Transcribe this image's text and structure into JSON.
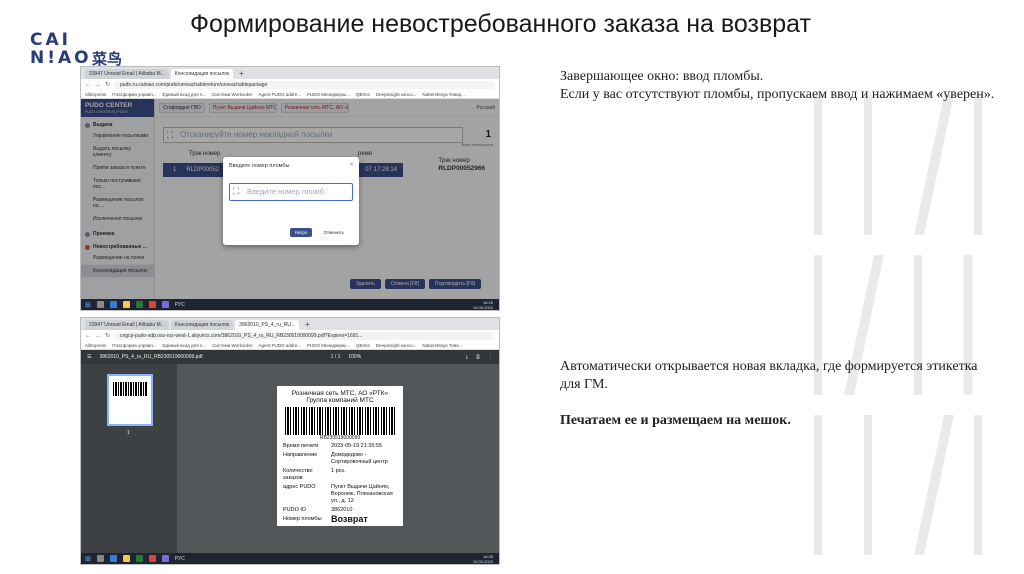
{
  "slide": {
    "logo_line1": "CAI",
    "logo_line2": "N!AO",
    "logo_cn": "菜鸟",
    "title": "Формирование невостребованного заказа на возврат",
    "note1": "Завершающее окно: ввод пломбы.\nЕсли у вас отсутствуют пломбы, пропускаем ввод и нажимаем «уверен».",
    "note2_text": "Автоматически открывается новая вкладка, где формируется этикетка для ГМ.",
    "note2_bold": "Печатаем ее и размещаем на мешок."
  },
  "shot1": {
    "tabs": [
      "23947 Unread Email | Alibaba M...",
      "Консолидация посылок"
    ],
    "url": "pudo.ru.cainiao.com/pudo/unreachablereturn/unreachablepackage",
    "bookmarks": [
      "AliExpress",
      "Платформа управл...",
      "Единый вход для п...",
      "Система Workorder",
      "Agent PUDO addre...",
      "PUDO Менеджеры...",
      "QBIms",
      "Deepinsight консо...",
      "Nabershtsya Товар..."
    ],
    "brand": "PUDO CENTER",
    "brand_sub": "PUDO CENTER RU PUDO",
    "sidebar": {
      "section1": "Выдача",
      "section1_items": [
        "Управление посылками",
        "Выдать посылку клиенту",
        "Приём заказа в пункте",
        "Только поступившие пос...",
        "Размещение посылок на ...",
        "Исключения посылок"
      ],
      "section2": "Приемка",
      "section3": "Невостребованные ...",
      "section3_items": [
        "Размещение на полке",
        "Консолидация посылок"
      ]
    },
    "top_chips": [
      "Стафордия ГВО",
      "Пункт Выдачи Цайняо МТС Воронеж Плехановская ул., д. 12",
      "Розничная сеть МТС, АО «РТК» Группа компаний МТС"
    ],
    "user": "Русский",
    "scan_placeholder": "Отсканируйте номер накладной посылки",
    "count": "1",
    "count_label": "Всего потенциалов",
    "table_header": [
      "Трэк номер",
      "ремя"
    ],
    "row": {
      "index": "1",
      "track": "RLDP00052",
      "time": "07 17:28:14"
    },
    "side_track_label": "Трэк номер",
    "side_track_value": "RLDP00052966",
    "actions": [
      "Удалить",
      "Отмена [F8]",
      "Подтвердить [F9]"
    ],
    "modal": {
      "title": "Введите номер пломбы",
      "placeholder": "Введите номер пломб",
      "ok": "Натро",
      "cancel": "Отменить"
    },
    "clock_time": "16:25",
    "clock_date": "19.05.2023",
    "lang": "РУС"
  },
  "shot2": {
    "tabs": [
      "23947 Unread Email | Alibaba M...",
      "Консолидация посылок",
      "3862010_PS_4_ru_RU..."
    ],
    "url": "cngcp-pudo-sdp.oss-rus-west-1.aliyuncs.com/3862010_PS_4_ru_RU_RB230519000099.pdf?Expires=1681...",
    "bookmarks": [
      "AliExpress",
      "Платформа управл...",
      "Единый вход для п...",
      "Система Workorder",
      "Agent PUDO addre...",
      "PUDO Менеджеры...",
      "QBIms",
      "Deepinsight консо...",
      "Nabershtsya Това..."
    ],
    "pdf_name": "3862010_PS_4_ru_RU_RB230519000099.pdf",
    "pages": "1 / 1",
    "zoom": "100%",
    "thumb_number": "1",
    "label": {
      "header": "Розничная сеть МТС, АО «РТК» Группа компаний МТС",
      "barcode_number": "RB230519000099",
      "fields": [
        {
          "k": "Время печати",
          "v": "2023-05-19 21:35:55"
        },
        {
          "k": "Направление",
          "v": "Домодедово - Сортировочный центр"
        },
        {
          "k": "Количество заказов",
          "v": "1 pcs."
        },
        {
          "k": "адрес PUDO",
          "v": "Пункт Выдачи Цайняо, Воронеж, Плехановская ул., д. 12"
        },
        {
          "k": "PUDO ID",
          "v": "3862010"
        },
        {
          "k": "Номер пломбы",
          "v": ""
        }
      ],
      "stamp": "Возврат"
    },
    "clock_time": "16:35",
    "clock_date": "19.05.2023",
    "lang": "РУС"
  }
}
